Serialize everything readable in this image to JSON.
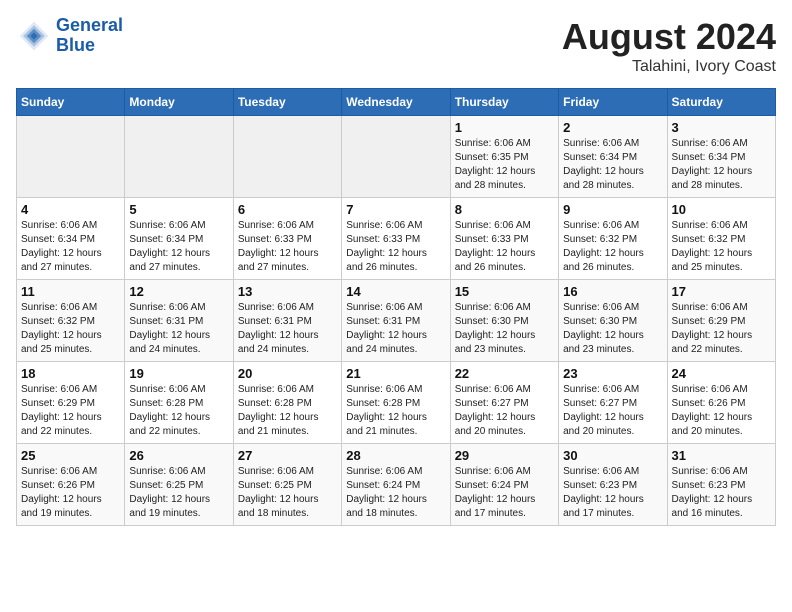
{
  "header": {
    "logo_line1": "General",
    "logo_line2": "Blue",
    "title": "August 2024",
    "subtitle": "Talahini, Ivory Coast"
  },
  "weekdays": [
    "Sunday",
    "Monday",
    "Tuesday",
    "Wednesday",
    "Thursday",
    "Friday",
    "Saturday"
  ],
  "weeks": [
    [
      {
        "day": "",
        "info": ""
      },
      {
        "day": "",
        "info": ""
      },
      {
        "day": "",
        "info": ""
      },
      {
        "day": "",
        "info": ""
      },
      {
        "day": "1",
        "info": "Sunrise: 6:06 AM\nSunset: 6:35 PM\nDaylight: 12 hours\nand 28 minutes."
      },
      {
        "day": "2",
        "info": "Sunrise: 6:06 AM\nSunset: 6:34 PM\nDaylight: 12 hours\nand 28 minutes."
      },
      {
        "day": "3",
        "info": "Sunrise: 6:06 AM\nSunset: 6:34 PM\nDaylight: 12 hours\nand 28 minutes."
      }
    ],
    [
      {
        "day": "4",
        "info": "Sunrise: 6:06 AM\nSunset: 6:34 PM\nDaylight: 12 hours\nand 27 minutes."
      },
      {
        "day": "5",
        "info": "Sunrise: 6:06 AM\nSunset: 6:34 PM\nDaylight: 12 hours\nand 27 minutes."
      },
      {
        "day": "6",
        "info": "Sunrise: 6:06 AM\nSunset: 6:33 PM\nDaylight: 12 hours\nand 27 minutes."
      },
      {
        "day": "7",
        "info": "Sunrise: 6:06 AM\nSunset: 6:33 PM\nDaylight: 12 hours\nand 26 minutes."
      },
      {
        "day": "8",
        "info": "Sunrise: 6:06 AM\nSunset: 6:33 PM\nDaylight: 12 hours\nand 26 minutes."
      },
      {
        "day": "9",
        "info": "Sunrise: 6:06 AM\nSunset: 6:32 PM\nDaylight: 12 hours\nand 26 minutes."
      },
      {
        "day": "10",
        "info": "Sunrise: 6:06 AM\nSunset: 6:32 PM\nDaylight: 12 hours\nand 25 minutes."
      }
    ],
    [
      {
        "day": "11",
        "info": "Sunrise: 6:06 AM\nSunset: 6:32 PM\nDaylight: 12 hours\nand 25 minutes."
      },
      {
        "day": "12",
        "info": "Sunrise: 6:06 AM\nSunset: 6:31 PM\nDaylight: 12 hours\nand 24 minutes."
      },
      {
        "day": "13",
        "info": "Sunrise: 6:06 AM\nSunset: 6:31 PM\nDaylight: 12 hours\nand 24 minutes."
      },
      {
        "day": "14",
        "info": "Sunrise: 6:06 AM\nSunset: 6:31 PM\nDaylight: 12 hours\nand 24 minutes."
      },
      {
        "day": "15",
        "info": "Sunrise: 6:06 AM\nSunset: 6:30 PM\nDaylight: 12 hours\nand 23 minutes."
      },
      {
        "day": "16",
        "info": "Sunrise: 6:06 AM\nSunset: 6:30 PM\nDaylight: 12 hours\nand 23 minutes."
      },
      {
        "day": "17",
        "info": "Sunrise: 6:06 AM\nSunset: 6:29 PM\nDaylight: 12 hours\nand 22 minutes."
      }
    ],
    [
      {
        "day": "18",
        "info": "Sunrise: 6:06 AM\nSunset: 6:29 PM\nDaylight: 12 hours\nand 22 minutes."
      },
      {
        "day": "19",
        "info": "Sunrise: 6:06 AM\nSunset: 6:28 PM\nDaylight: 12 hours\nand 22 minutes."
      },
      {
        "day": "20",
        "info": "Sunrise: 6:06 AM\nSunset: 6:28 PM\nDaylight: 12 hours\nand 21 minutes."
      },
      {
        "day": "21",
        "info": "Sunrise: 6:06 AM\nSunset: 6:28 PM\nDaylight: 12 hours\nand 21 minutes."
      },
      {
        "day": "22",
        "info": "Sunrise: 6:06 AM\nSunset: 6:27 PM\nDaylight: 12 hours\nand 20 minutes."
      },
      {
        "day": "23",
        "info": "Sunrise: 6:06 AM\nSunset: 6:27 PM\nDaylight: 12 hours\nand 20 minutes."
      },
      {
        "day": "24",
        "info": "Sunrise: 6:06 AM\nSunset: 6:26 PM\nDaylight: 12 hours\nand 20 minutes."
      }
    ],
    [
      {
        "day": "25",
        "info": "Sunrise: 6:06 AM\nSunset: 6:26 PM\nDaylight: 12 hours\nand 19 minutes."
      },
      {
        "day": "26",
        "info": "Sunrise: 6:06 AM\nSunset: 6:25 PM\nDaylight: 12 hours\nand 19 minutes."
      },
      {
        "day": "27",
        "info": "Sunrise: 6:06 AM\nSunset: 6:25 PM\nDaylight: 12 hours\nand 18 minutes."
      },
      {
        "day": "28",
        "info": "Sunrise: 6:06 AM\nSunset: 6:24 PM\nDaylight: 12 hours\nand 18 minutes."
      },
      {
        "day": "29",
        "info": "Sunrise: 6:06 AM\nSunset: 6:24 PM\nDaylight: 12 hours\nand 17 minutes."
      },
      {
        "day": "30",
        "info": "Sunrise: 6:06 AM\nSunset: 6:23 PM\nDaylight: 12 hours\nand 17 minutes."
      },
      {
        "day": "31",
        "info": "Sunrise: 6:06 AM\nSunset: 6:23 PM\nDaylight: 12 hours\nand 16 minutes."
      }
    ]
  ]
}
